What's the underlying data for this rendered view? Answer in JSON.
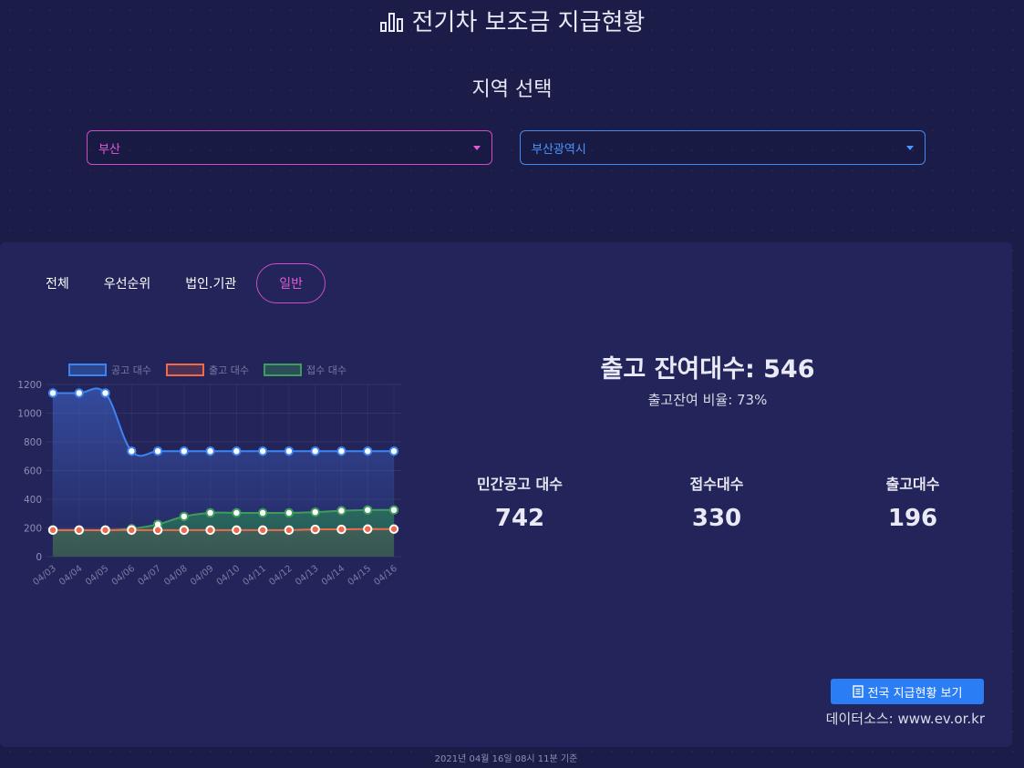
{
  "header": {
    "title": "전기차 보조금 지급현황",
    "region_title": "지역 선택"
  },
  "selectors": {
    "province": "부산",
    "city": "부산광역시"
  },
  "tabs": [
    {
      "label": "전체",
      "active": false
    },
    {
      "label": "우선순위",
      "active": false
    },
    {
      "label": "법인.기관",
      "active": false
    },
    {
      "label": "일반",
      "active": true
    }
  ],
  "summary": {
    "remaining_label": "출고 잔여대수: 546",
    "ratio_label": "출고잔여 비율: 73%"
  },
  "stats": [
    {
      "label": "민간공고 대수",
      "value": "742"
    },
    {
      "label": "접수대수",
      "value": "330"
    },
    {
      "label": "출고대수",
      "value": "196"
    }
  ],
  "actions": {
    "nation_button": "전국 지급현황 보기"
  },
  "source_text": "데이터소스: www.ev.or.kr",
  "footer_text": "2021년 04월 16일 08시 11분 기준",
  "colors": {
    "accent_pink": "#e25ad3",
    "accent_blue": "#4b97ff",
    "announce": "#3d84f2",
    "delivered": "#f06a4a",
    "received": "#3f9d5c"
  },
  "chart_data": {
    "type": "line",
    "categories": [
      "04/03",
      "04/04",
      "04/05",
      "04/06",
      "04/07",
      "04/08",
      "04/09",
      "04/10",
      "04/11",
      "04/12",
      "04/13",
      "04/14",
      "04/15",
      "04/16"
    ],
    "ylim": [
      0,
      1200
    ],
    "yticks": [
      0,
      200,
      400,
      600,
      800,
      1000,
      1200
    ],
    "grid": true,
    "legend_position": "top",
    "series": [
      {
        "name": "공고 대수",
        "color": "#3d84f2",
        "values": [
          1140,
          1140,
          1140,
          735,
          735,
          735,
          735,
          735,
          735,
          735,
          735,
          735,
          735,
          735
        ]
      },
      {
        "name": "출고 대수",
        "color": "#f06a4a",
        "values": [
          185,
          185,
          185,
          185,
          185,
          185,
          185,
          185,
          185,
          185,
          190,
          190,
          192,
          192
        ]
      },
      {
        "name": "접수 대수",
        "color": "#3f9d5c",
        "values": [
          185,
          185,
          185,
          195,
          225,
          280,
          305,
          305,
          305,
          305,
          310,
          320,
          325,
          325
        ]
      }
    ]
  }
}
